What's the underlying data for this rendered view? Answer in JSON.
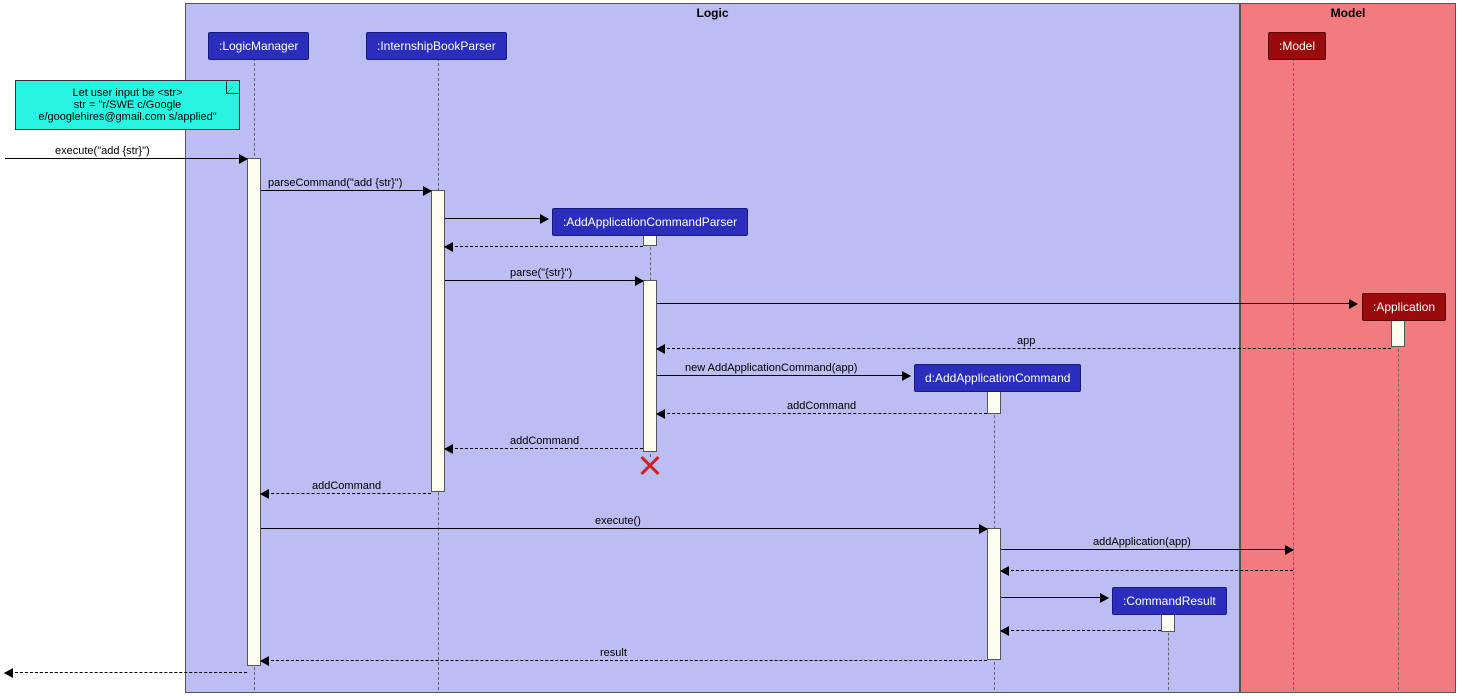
{
  "regions": {
    "logic": "Logic",
    "model": "Model"
  },
  "participants": {
    "logicManager": ":LogicManager",
    "internshipBookParser": ":InternshipBookParser",
    "addAppCmdParser": ":AddApplicationCommandParser",
    "addAppCmd": "d:AddApplicationCommand",
    "commandResult": ":CommandResult",
    "model": ":Model",
    "application": ":Application"
  },
  "note": {
    "line1": "Let user input be <str>",
    "line2": "str = \"r/SWE c/Google",
    "line3": "e/googlehires@gmail.com s/applied\""
  },
  "messages": {
    "execute1": "execute(\"add {str}\")",
    "parseCommand": "parseCommand(\"add {str}\")",
    "parse": "parse(\"{str}\")",
    "app": "app",
    "newAddCmd": "new AddApplicationCommand(app)",
    "addCommand": "addCommand",
    "execute2": "execute()",
    "addApplication": "addApplication(app)",
    "result": "result"
  }
}
